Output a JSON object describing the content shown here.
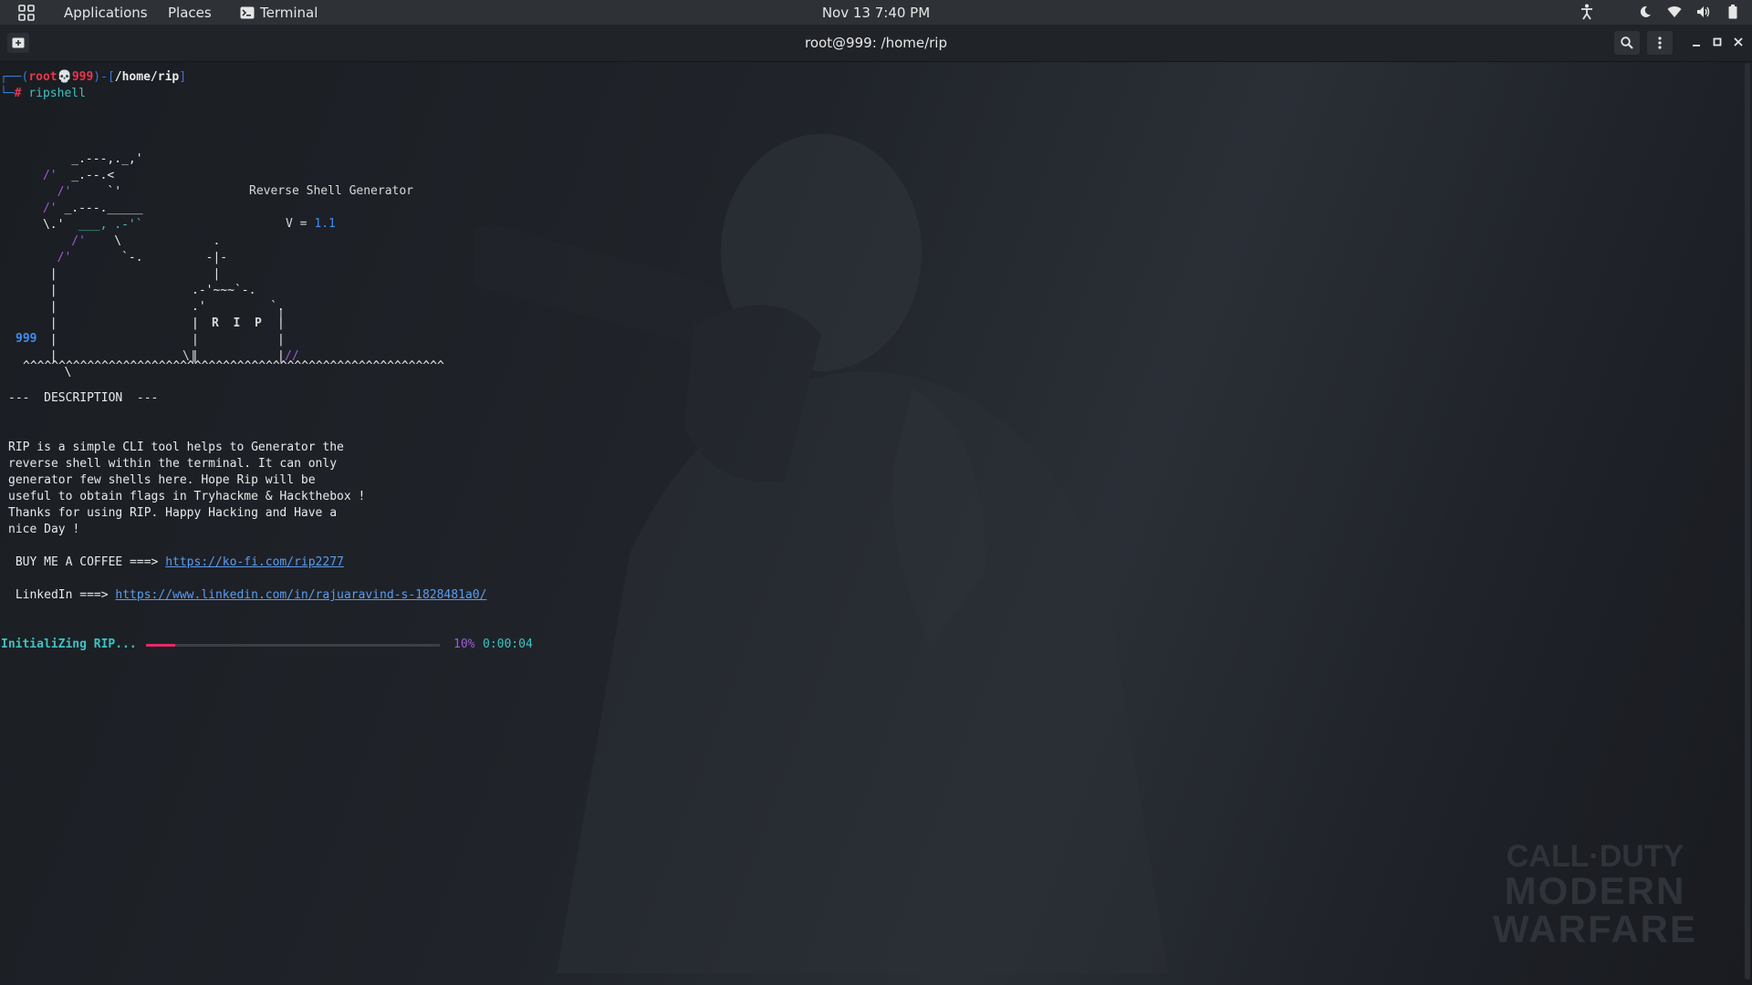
{
  "topbar": {
    "applications": "Applications",
    "places": "Places",
    "terminal": "Terminal",
    "clock": "Nov 13  7:40 PM",
    "icons": [
      "accessibility-icon",
      "night-light-icon",
      "wifi-icon",
      "volume-icon",
      "battery-icon"
    ]
  },
  "window": {
    "title": "root@999: /home/rip"
  },
  "prompt": {
    "open": "┌──(",
    "user": "root",
    "skull": "💀",
    "host": "999",
    "mid": ")-[",
    "path": "/home/rip",
    "close": "]",
    "corner": "└─",
    "hash": "#",
    "command": "ripshell"
  },
  "banner": {
    "title": "Reverse Shell Generator",
    "version_label": "V = ",
    "version": "1.1",
    "tag": "999",
    "rip": "R  I  P",
    "ground": "^^^^^^^^^^^^^^^^^^^^^^^^^^^^^^^^^^^^^^^^^^^^^^^^^^^^^^^^^^^"
  },
  "description": {
    "heading": "---  DESCRIPTION  ---",
    "lines": [
      "RIP is a simple CLI tool helps to Generator the",
      "reverse shell within the terminal. It can only",
      "generator few shells here. Hope Rip will be",
      "useful to obtain flags in Tryhackme & Hackthebox !",
      "Thanks for using RIP. Happy Hacking and Have a",
      "nice Day !"
    ],
    "coffee_label": " BUY ME A COFFEE ===> ",
    "coffee_url": "https://ko-fi.com/rip2277",
    "linkedin_label": " LinkedIn ===> ",
    "linkedin_url": "https://www.linkedin.com/in/rajuaravind-s-1828481a0/"
  },
  "progress": {
    "label": "InitialiZing RIP...",
    "percent_text": "10%",
    "elapsed": "0:00:04",
    "fraction": 0.1
  },
  "watermark": {
    "line1": "CALL·DUTY",
    "line2": "MODERN",
    "line3": "WARFARE"
  },
  "colors": {
    "accent_pink": "#e22a6a",
    "prompt_blue": "#3a7bd5",
    "prompt_red": "#e8364b",
    "cyan": "#3fc3c3"
  }
}
